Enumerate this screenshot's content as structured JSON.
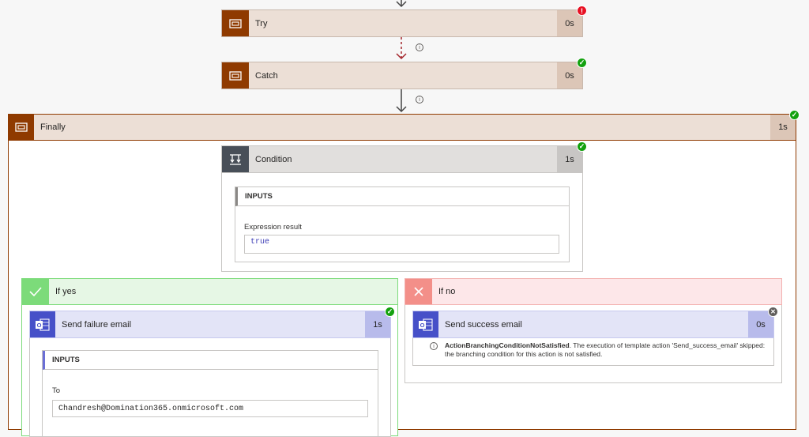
{
  "steps": {
    "try": {
      "title": "Try",
      "duration": "0s",
      "status": "!"
    },
    "catch": {
      "title": "Catch",
      "duration": "0s",
      "status": "✓"
    },
    "finally": {
      "title": "Finally",
      "duration": "1s",
      "status": "✓"
    }
  },
  "condition": {
    "title": "Condition",
    "duration": "1s",
    "status": "✓",
    "inputs_label": "INPUTS",
    "expression_label": "Expression result",
    "expression_value": "true"
  },
  "branches": {
    "yes": {
      "label": "If yes",
      "action": {
        "title": "Send failure email",
        "duration": "1s",
        "status": "✓",
        "inputs_label": "INPUTS",
        "to_label": "To",
        "to_value": "Chandresh@Domination365.onmicrosoft.com"
      }
    },
    "no": {
      "label": "If no",
      "action": {
        "title": "Send success email",
        "duration": "0s",
        "status": "✕",
        "message_bold": "ActionBranchingConditionNotSatisfied",
        "message_rest": ". The execution of template action 'Send_success_email' skipped: the branching condition for this action is not satisfied."
      }
    }
  },
  "colors": {
    "scope_brown": "#8f3a00",
    "scope_bg": "#ecdfd6",
    "condition_icon": "#484f58",
    "outlook_blue": "#4650c8",
    "yes_green": "#7cdb7a",
    "no_red": "#f38f89"
  },
  "icons": {
    "scope": "scope-icon",
    "condition": "condition-icon",
    "outlook": "outlook-icon",
    "info": "info-icon"
  }
}
